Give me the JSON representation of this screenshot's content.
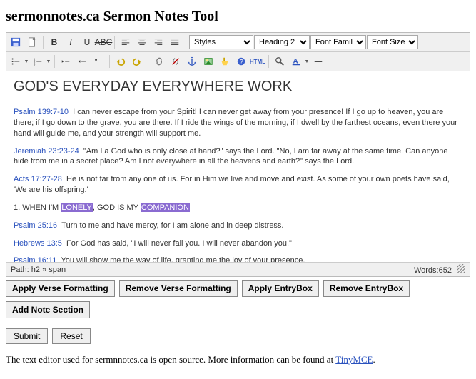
{
  "page": {
    "title": "sermonnotes.ca Sermon Notes Tool"
  },
  "toolbar": {
    "selects": {
      "styles": "Styles",
      "heading": "Heading 2",
      "fontFamily": "Font Family",
      "fontSize": "Font Size"
    },
    "labels": {
      "save": "Save",
      "newdoc": "New Document",
      "bold": "Bold",
      "italic": "Italic",
      "underline": "Underline",
      "strike": "Strikethrough",
      "alignLeft": "Align Left",
      "alignCenter": "Align Center",
      "alignRight": "Align Right",
      "alignFull": "Align Full",
      "bulletList": "Unordered list",
      "numList": "Ordered list",
      "outdent": "Outdent",
      "indent": "Indent",
      "blockquote": "Blockquote",
      "undo": "Undo",
      "redo": "Redo",
      "link": "Insert link",
      "unlink": "Unlink",
      "anchor": "Anchor",
      "image": "Insert image",
      "cleanup": "Cleanup",
      "help": "Help",
      "html": "Edit HTML",
      "find": "Find",
      "forecolor": "Text color",
      "hr": "Horizontal rule"
    }
  },
  "document": {
    "heading": "GOD'S EVERYDAY EVERYWHERE WORK",
    "blocks": [
      {
        "ref": "Psalm 139:7-10",
        "text": "I can never escape from your Spirit! I can never get away from your presence! If I go up to heaven, you are there; if I go down to the grave, you are there. If I ride the wings of the morning, if I dwell by the farthest oceans, even there your hand will guide me, and your strength will support me."
      },
      {
        "ref": "Jeremiah 23:23-24",
        "text": "\"Am I a God who is only close at hand?\" says the Lord. \"No, I am far away at the same time. Can anyone hide from me in a secret place? Am I not everywhere in all the heavens and earth?\" says the Lord."
      },
      {
        "ref": "Acts 17:27-28",
        "text": "He is not far from any one of us. For in Him we live and move and exist. As some of your own poets have said, 'We are his offspring.'"
      }
    ],
    "numbered": {
      "pre": "1.  WHEN I'M ",
      "hi1": "LONELY",
      "mid": ", GOD IS MY ",
      "hi2": "COMPANION"
    },
    "blocks2": [
      {
        "ref": "Psalm 25:16",
        "text": "Turn to me and have mercy, for I am alone and in deep distress."
      },
      {
        "ref": "Hebrews 13:5",
        "text": "For God has said, \"I will never fail you. I will never abandon you.\""
      },
      {
        "ref": "Psalm 16:11",
        "text": "You will show me the way of life, granting me the joy of your presence."
      }
    ]
  },
  "statusBar": {
    "pathLabel": "Path: ",
    "path": "h2 » span",
    "wordsLabel": "Words:",
    "words": "652"
  },
  "buttons": {
    "applyVerse": "Apply Verse Formatting",
    "removeVerse": "Remove Verse Formatting",
    "applyEntry": "Apply EntryBox",
    "removeEntry": "Remove EntryBox",
    "addNote": "Add Note Section",
    "submit": "Submit",
    "reset": "Reset"
  },
  "footer": {
    "text": "The text editor used for sermnnotes.ca is open source.  More information can be found at ",
    "linkText": "TinyMCE",
    "suffix": "."
  }
}
